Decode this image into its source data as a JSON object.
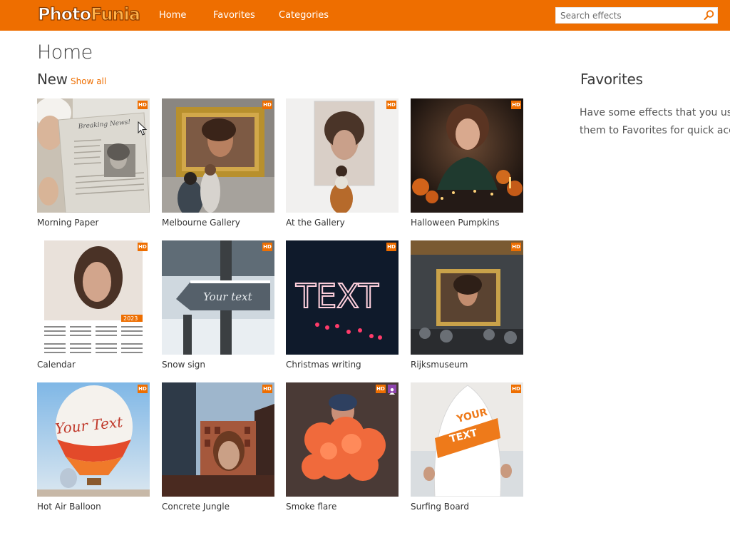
{
  "header": {
    "logo_part1": "Photo",
    "logo_part2": "Funia",
    "nav": [
      "Home",
      "Favorites",
      "Categories"
    ],
    "search_placeholder": "Search effects"
  },
  "page_title": "Home",
  "new_section": {
    "title": "New",
    "show_all": "Show all"
  },
  "side": {
    "title": "Favorites",
    "line1": "Have some effects that you use",
    "line2": "them to Favorites for quick acc"
  },
  "badge_hd": "HD",
  "effects": [
    {
      "label": "Morning Paper",
      "badges": [
        "HD"
      ]
    },
    {
      "label": "Melbourne Gallery",
      "badges": [
        "HD"
      ]
    },
    {
      "label": "At the Gallery",
      "badges": [
        "HD"
      ]
    },
    {
      "label": "Halloween Pumpkins",
      "badges": [
        "HD"
      ]
    },
    {
      "label": "Calendar",
      "badges": [
        "HD"
      ]
    },
    {
      "label": "Snow sign",
      "badges": [
        "HD"
      ]
    },
    {
      "label": "Christmas writing",
      "badges": [
        "HD"
      ]
    },
    {
      "label": "Rijksmuseum",
      "badges": [
        "HD"
      ]
    },
    {
      "label": "Hot Air Balloon",
      "badges": [
        "HD"
      ]
    },
    {
      "label": "Concrete Jungle",
      "badges": [
        "HD"
      ]
    },
    {
      "label": "Smoke flare",
      "badges": [
        "HD",
        "user"
      ]
    },
    {
      "label": "Surfing Board",
      "badges": [
        "HD"
      ]
    }
  ],
  "thumb_text": {
    "newspaper": "Breaking News!",
    "snow_sign": "Your text",
    "christmas": "TEXT",
    "calendar_year": "2023",
    "balloon": "Your Text",
    "surf_line1": "YOUR",
    "surf_line2": "TEXT"
  },
  "colors": {
    "brand_orange": "#ee6e00",
    "user_badge": "#8e44ad"
  }
}
